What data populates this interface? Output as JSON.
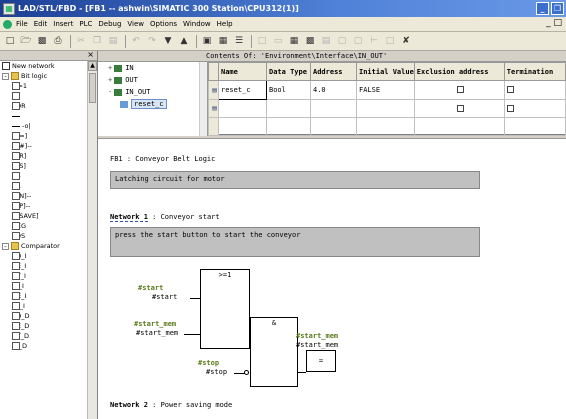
{
  "window": {
    "title": "LAD/STL/FBD  - [FB1 -- ashwin\\SIMATIC 300 Station\\CPU312(1)]"
  },
  "menu": {
    "items": [
      "File",
      "Edit",
      "Insert",
      "PLC",
      "Debug",
      "View",
      "Options",
      "Window",
      "Help"
    ]
  },
  "catalog": {
    "items": [
      {
        "label": "New network",
        "icon": "new-network-icon",
        "level": 0
      },
      {
        "label": "Bit logic",
        "icon": "folder-icon",
        "level": 0,
        "expander": "-"
      },
      {
        "label": ">=1",
        "icon": "block-icon",
        "level": 1
      },
      {
        "label": "&",
        "icon": "block-icon",
        "level": 1
      },
      {
        "label": "XOR",
        "icon": "block-icon",
        "level": 1
      },
      {
        "label": "",
        "icon": "line-icon",
        "level": 1
      },
      {
        "label": "-o|",
        "icon": "line-icon",
        "level": 1
      },
      {
        "label": "--[=]",
        "icon": "block-icon",
        "level": 1
      },
      {
        "label": "--[#]--",
        "icon": "block-icon",
        "level": 1
      },
      {
        "label": "--[R]",
        "icon": "block-icon",
        "level": 1
      },
      {
        "label": "--[S]",
        "icon": "block-icon",
        "level": 1
      },
      {
        "label": "RS",
        "icon": "block-icon",
        "level": 1
      },
      {
        "label": "SR",
        "icon": "block-icon",
        "level": 1
      },
      {
        "label": "--[N]--",
        "icon": "block-icon",
        "level": 1
      },
      {
        "label": "--[P]--",
        "icon": "block-icon",
        "level": 1
      },
      {
        "label": "--[SAVE]",
        "icon": "block-icon",
        "level": 1
      },
      {
        "label": "NEG",
        "icon": "block-icon",
        "level": 1
      },
      {
        "label": "POS",
        "icon": "block-icon",
        "level": 1
      },
      {
        "label": "Comparator",
        "icon": "comparator-folder-icon",
        "level": 0,
        "expander": "-"
      },
      {
        "label": "EQ_I",
        "icon": "block-icon",
        "level": 1
      },
      {
        "label": "NE_I",
        "icon": "block-icon",
        "level": 1
      },
      {
        "label": "GT_I",
        "icon": "block-icon",
        "level": 1
      },
      {
        "label": "LT_I",
        "icon": "block-icon",
        "level": 1
      },
      {
        "label": "GE_I",
        "icon": "block-icon",
        "level": 1
      },
      {
        "label": "LE_I",
        "icon": "block-icon",
        "level": 1
      },
      {
        "label": "EQ_D",
        "icon": "block-icon",
        "level": 1
      },
      {
        "label": "NE_D",
        "icon": "block-icon",
        "level": 1
      },
      {
        "label": "GT_D",
        "icon": "block-icon",
        "level": 1
      },
      {
        "label": "LT_D",
        "icon": "block-icon",
        "level": 1
      }
    ]
  },
  "interface": {
    "header": "Contents Of: 'Environment\\Interface\\IN_OUT'",
    "tree": [
      {
        "expander": "+",
        "label": "IN"
      },
      {
        "expander": "+",
        "label": "OUT"
      },
      {
        "expander": "-",
        "label": "IN_OUT"
      },
      {
        "expander": "",
        "label": "reset_c",
        "selected": true
      }
    ],
    "columns": [
      "Name",
      "Data Type",
      "Address",
      "Initial Value",
      "Exclusion address",
      "Termination"
    ],
    "rows": [
      {
        "name": "reset_c",
        "type": "Bool",
        "address": "4.0",
        "initial": "FALSE"
      },
      {
        "name": "",
        "type": "",
        "address": "",
        "initial": ""
      }
    ]
  },
  "editor": {
    "block_title": "FB1 : Conveyor Belt Logic",
    "block_comment": "Latching circuit for motor",
    "network1": {
      "label": "Network 1",
      "title": ": Conveyor start",
      "comment": "press the start button to start the conveyor"
    },
    "fbd": {
      "or_block": ">=1",
      "and_block": "&",
      "assign_block": "=",
      "start_symbol": "#start",
      "start_operand": "#start",
      "start_mem_symbol": "#start_mem",
      "start_mem_operand": "#start_mem",
      "stop_symbol": "#stop",
      "stop_operand": "#stop",
      "out_symbol": "#start_mem",
      "out_operand": "#start_mem"
    },
    "network2": {
      "label": "Network 2",
      "title": ": Power saving mode"
    }
  }
}
